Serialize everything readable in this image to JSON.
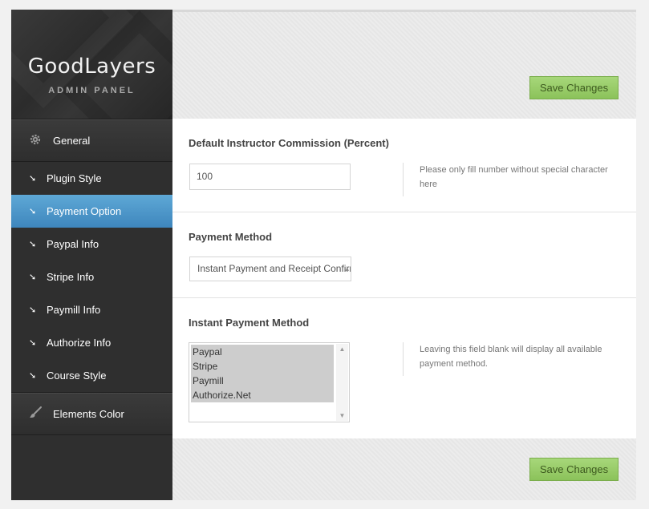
{
  "brand": {
    "title": "GoodLayers",
    "subtitle": "ADMIN PANEL"
  },
  "sidebar": {
    "general": {
      "label": "General",
      "icon": "gear-icon"
    },
    "items": [
      {
        "label": "Plugin Style",
        "icon": "arrow-down-right-icon",
        "active": false
      },
      {
        "label": "Payment Option",
        "icon": "arrow-down-right-icon",
        "active": true
      },
      {
        "label": "Paypal Info",
        "icon": "arrow-down-right-icon",
        "active": false
      },
      {
        "label": "Stripe Info",
        "icon": "arrow-down-right-icon",
        "active": false
      },
      {
        "label": "Paymill Info",
        "icon": "arrow-down-right-icon",
        "active": false
      },
      {
        "label": "Authorize Info",
        "icon": "arrow-down-right-icon",
        "active": false
      },
      {
        "label": "Course Style",
        "icon": "arrow-down-right-icon",
        "active": false
      }
    ],
    "elements_color": {
      "label": "Elements Color",
      "icon": "paintbrush-icon"
    }
  },
  "toolbar": {
    "save_label": "Save Changes"
  },
  "options": {
    "commission": {
      "title": "Default Instructor Commission (Percent)",
      "value": "100",
      "description": "Please only fill number without special character here"
    },
    "payment_method": {
      "title": "Payment Method",
      "selected": "Instant Payment and Receipt Confirmation"
    },
    "instant_payment_method": {
      "title": "Instant Payment Method",
      "options": [
        "Paypal",
        "Stripe",
        "Paymill",
        "Authorize.Net"
      ],
      "description": "Leaving this field blank will display all available payment method."
    }
  },
  "colors": {
    "accent_active": "#4a95c9",
    "save_button": "#9ccd6e",
    "sidebar_bg": "#2f2f2f"
  }
}
